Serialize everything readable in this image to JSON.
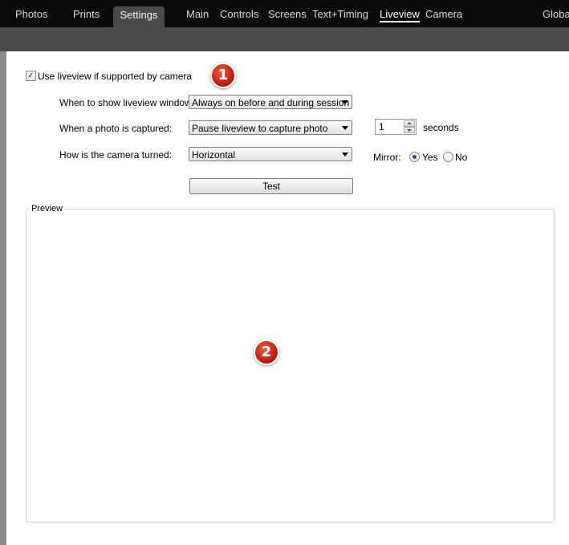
{
  "main_tabs": [
    "Photos",
    "Prints",
    "Settings"
  ],
  "sub_tabs": [
    "Main",
    "Controls",
    "Screens",
    "Text+Timing",
    "Liveview",
    "Camera",
    "Global"
  ],
  "options": {
    "use_liveview_label": "Use liveview if supported by camera",
    "use_liveview_checked": true,
    "when_show_label": "When to show liveview window:",
    "when_show_value": "Always on before and during session",
    "photo_captured_label": "When a photo is captured:",
    "photo_captured_value": "Pause liveview to capture photo",
    "seconds_value": "1",
    "seconds_label": "seconds",
    "camera_turned_label": "How is the camera turned:",
    "camera_turned_value": "Horizontal",
    "mirror_label": "Mirror:",
    "mirror_yes": "Yes",
    "mirror_no": "No",
    "mirror_selected": "Yes",
    "test_button": "Test"
  },
  "preview": {
    "label": "Preview"
  },
  "badges": [
    "1",
    "2"
  ],
  "colors": {
    "topbar": "#0b0b0b",
    "active_tab": "#4a4a4a",
    "badge": "#d8261a"
  }
}
